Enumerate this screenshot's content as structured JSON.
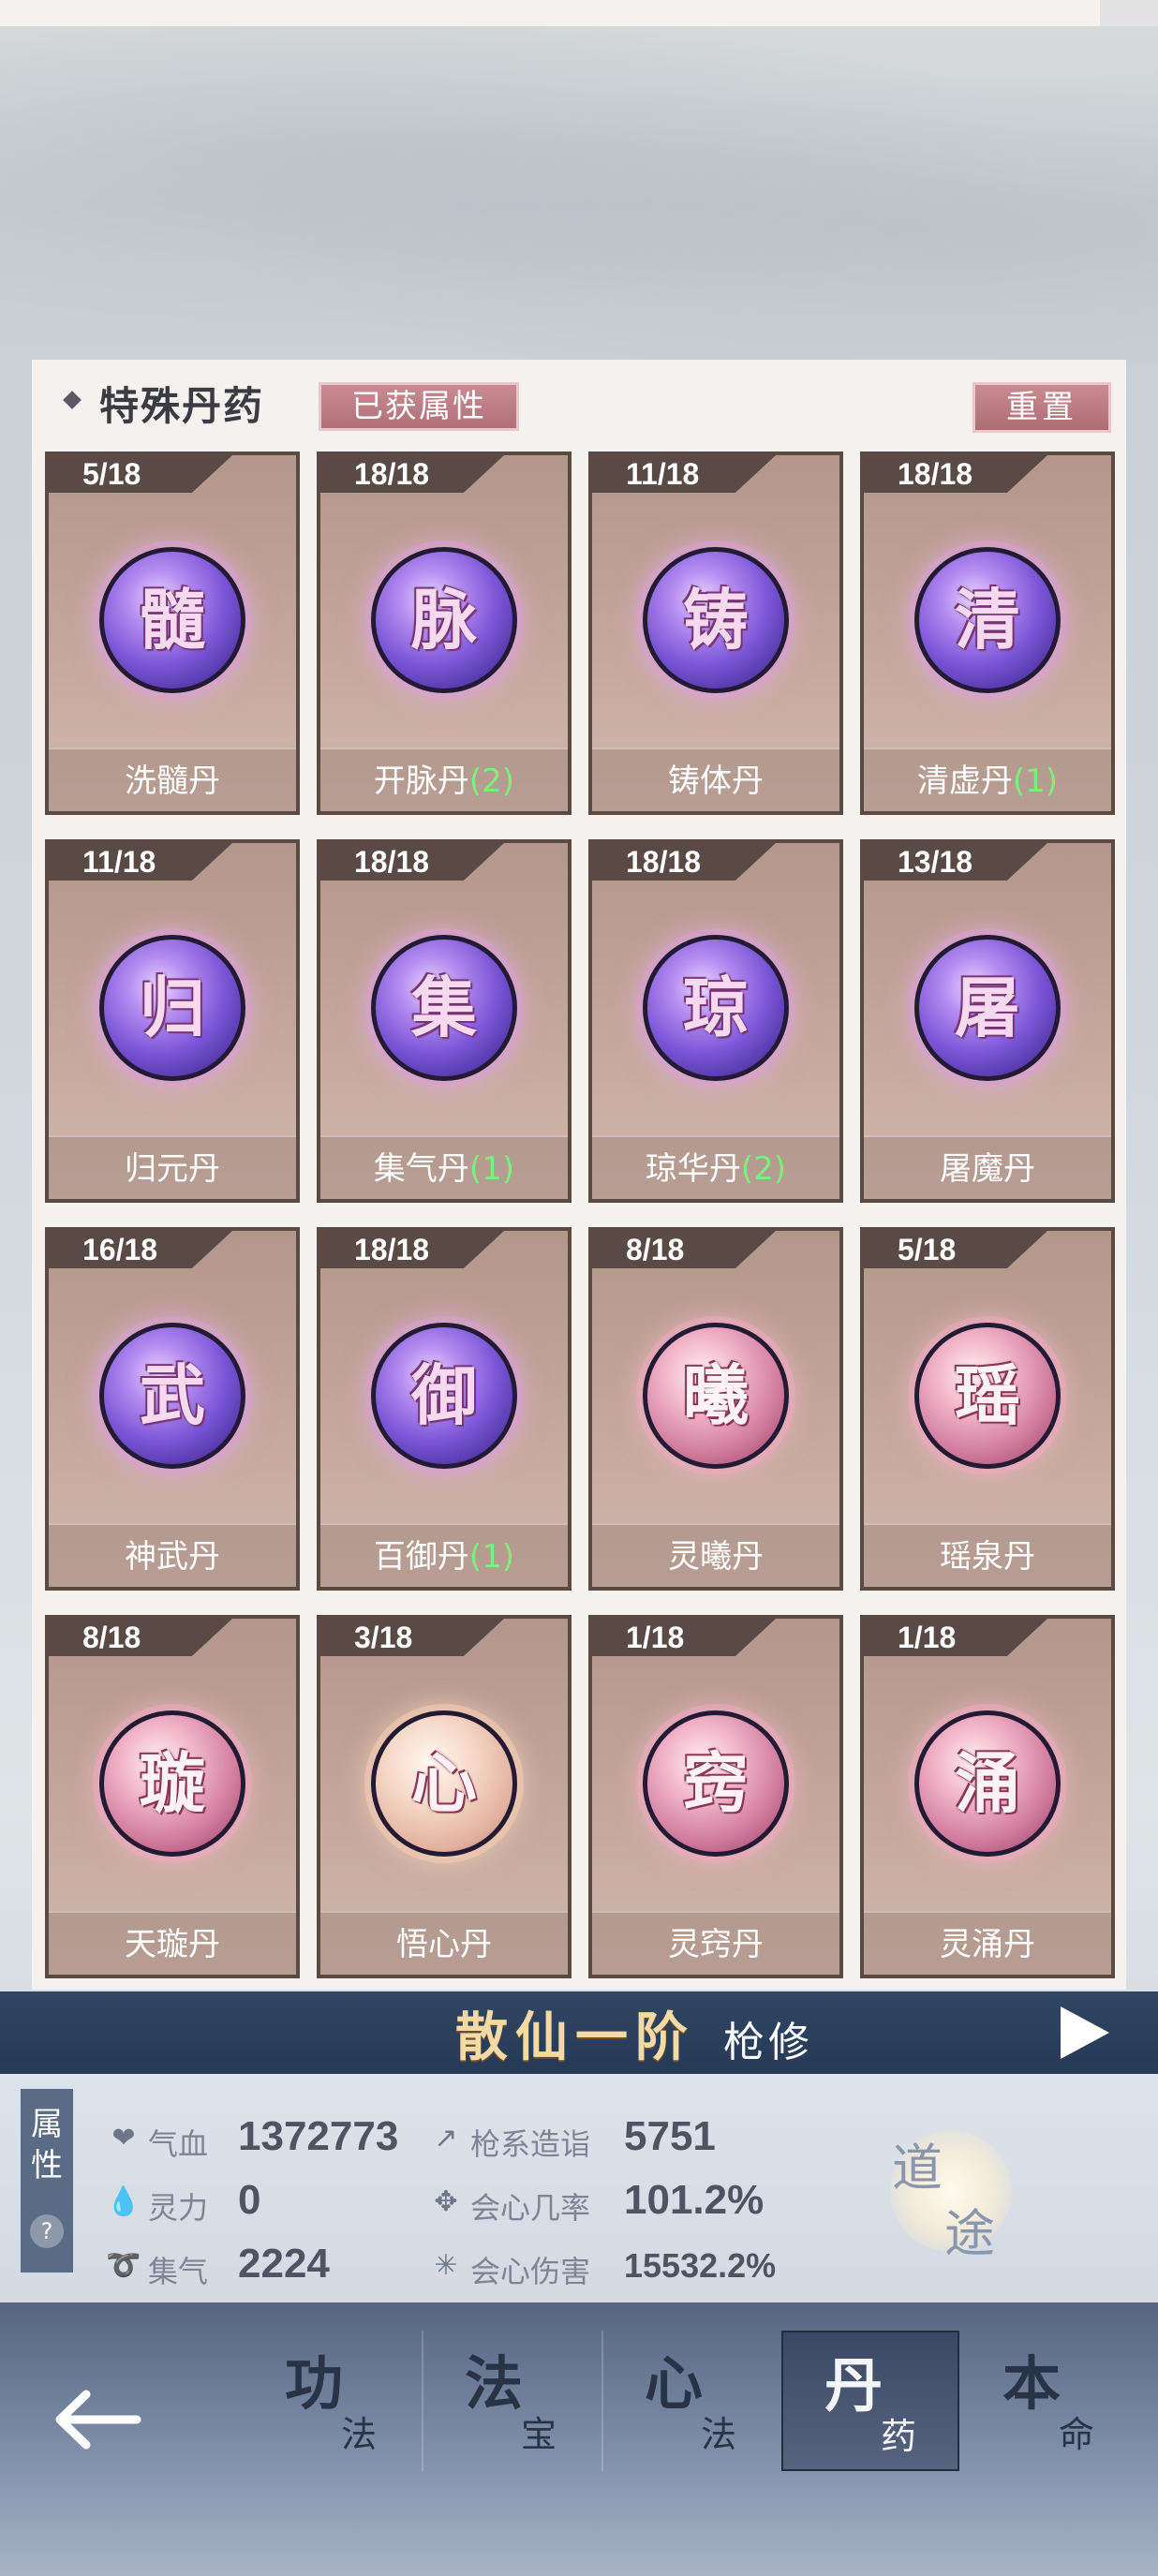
{
  "panel": {
    "title": "特殊丹药",
    "tag": "已获属性",
    "reset": "重置"
  },
  "pills": [
    {
      "count": "5/18",
      "char": "髓",
      "name": "洗髓丹",
      "suffix": "",
      "style": "purple"
    },
    {
      "count": "18/18",
      "char": "脉",
      "name": "开脉丹",
      "suffix": "(2)",
      "style": "purple"
    },
    {
      "count": "11/18",
      "char": "铸",
      "name": "铸体丹",
      "suffix": "",
      "style": "purple"
    },
    {
      "count": "18/18",
      "char": "清",
      "name": "清虚丹",
      "suffix": "(1)",
      "style": "purple"
    },
    {
      "count": "11/18",
      "char": "归",
      "name": "归元丹",
      "suffix": "",
      "style": "purple"
    },
    {
      "count": "18/18",
      "char": "集",
      "name": "集气丹",
      "suffix": "(1)",
      "style": "purple"
    },
    {
      "count": "18/18",
      "char": "琼",
      "name": "琼华丹",
      "suffix": "(2)",
      "style": "purple"
    },
    {
      "count": "13/18",
      "char": "屠",
      "name": "屠魔丹",
      "suffix": "",
      "style": "purple"
    },
    {
      "count": "16/18",
      "char": "武",
      "name": "神武丹",
      "suffix": "",
      "style": "purple"
    },
    {
      "count": "18/18",
      "char": "御",
      "name": "百御丹",
      "suffix": "(1)",
      "style": "purple"
    },
    {
      "count": "8/18",
      "char": "曦",
      "name": "灵曦丹",
      "suffix": "",
      "style": "pink"
    },
    {
      "count": "5/18",
      "char": "瑶",
      "name": "瑶泉丹",
      "suffix": "",
      "style": "pink"
    },
    {
      "count": "8/18",
      "char": "璇",
      "name": "天璇丹",
      "suffix": "",
      "style": "pink"
    },
    {
      "count": "3/18",
      "char": "心",
      "name": "悟心丹",
      "suffix": "",
      "style": "gold"
    },
    {
      "count": "1/18",
      "char": "窍",
      "name": "灵窍丹",
      "suffix": "",
      "style": "pink"
    },
    {
      "count": "1/18",
      "char": "涌",
      "name": "灵涌丹",
      "suffix": "",
      "style": "pink"
    }
  ],
  "realm": {
    "title": "散仙一阶",
    "sub": "枪修"
  },
  "stats_panel": {
    "tab": "属性",
    "help": "?",
    "stats": [
      {
        "icon": "heart-icon",
        "label": "气血",
        "value": "1372773"
      },
      {
        "icon": "spirit-icon",
        "label": "灵力",
        "value": "0"
      },
      {
        "icon": "swirl-icon",
        "label": "集气",
        "value": "2224"
      },
      {
        "icon": "spear-icon",
        "label": "枪系造诣",
        "value": "5751"
      },
      {
        "icon": "crit-rate-icon",
        "label": "会心几率",
        "value": "101.2%"
      },
      {
        "icon": "crit-dmg-icon",
        "label": "会心伤害",
        "value": "15532.2%"
      }
    ],
    "daotu": [
      "道",
      "途"
    ]
  },
  "nav": [
    {
      "big": "功",
      "small": "法"
    },
    {
      "big": "法",
      "small": "宝"
    },
    {
      "big": "心",
      "small": "法"
    },
    {
      "big": "丹",
      "small": "药",
      "active": true
    },
    {
      "big": "本",
      "small": "命"
    }
  ],
  "colors": {
    "accent_tag": "#b07078",
    "suffix_green": "#7df07b",
    "realm_bar": "#2f4664",
    "realm_title": "#f4d9a4"
  }
}
